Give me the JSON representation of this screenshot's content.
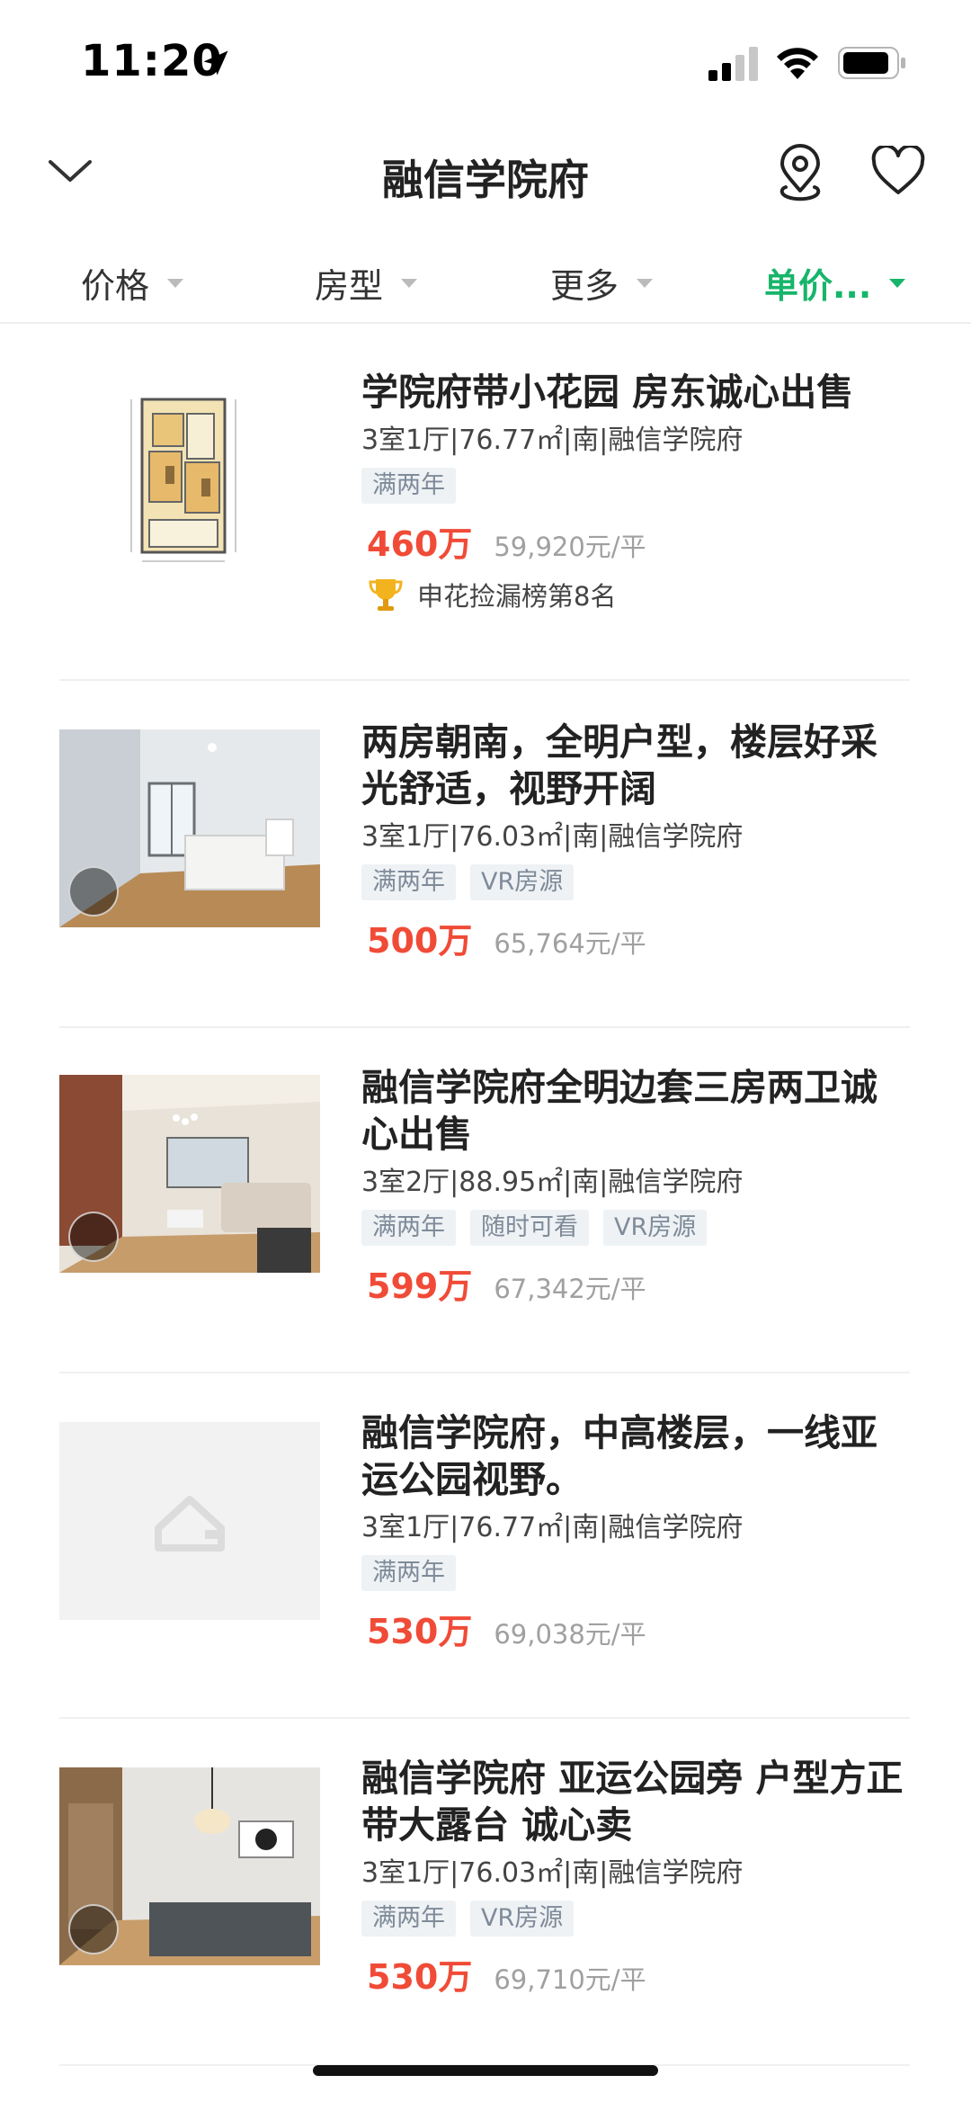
{
  "status_bar": {
    "time": "11:20"
  },
  "header": {
    "title": "融信学院府"
  },
  "filters": [
    {
      "label": "价格",
      "active": false
    },
    {
      "label": "房型",
      "active": false
    },
    {
      "label": "更多",
      "active": false
    },
    {
      "label": "单价...",
      "active": true
    }
  ],
  "listings": [
    {
      "title": "学院府带小花园  房东诚心出售",
      "meta": "3室1厅|76.77㎡|南|融信学院府",
      "tags": [
        "满两年"
      ],
      "price": "460万",
      "unit_price": "59,920元/平",
      "rank": "申花捡漏榜第8名",
      "image": "floor-plan"
    },
    {
      "title": "两房朝南，全明户型，楼层好采光舒适，视野开阔",
      "meta": "3室1厅|76.03㎡|南|融信学院府",
      "tags": [
        "满两年",
        "VR房源"
      ],
      "price": "500万",
      "unit_price": "65,764元/平",
      "image": "bedroom-photo"
    },
    {
      "title": "融信学院府全明边套三房两卫诚心出售",
      "meta": "3室2厅|88.95㎡|南|融信学院府",
      "tags": [
        "满两年",
        "随时可看",
        "VR房源"
      ],
      "price": "599万",
      "unit_price": "67,342元/平",
      "image": "living-room-photo"
    },
    {
      "title": "融信学院府，中高楼层，一线亚运公园视野。",
      "meta": "3室1厅|76.77㎡|南|融信学院府",
      "tags": [
        "满两年"
      ],
      "price": "530万",
      "unit_price": "69,038元/平",
      "image": "placeholder"
    },
    {
      "title": "融信学院府 亚运公园旁 户型方正 带大露台  诚心卖",
      "meta": "3室1厅|76.03㎡|南|融信学院府",
      "tags": [
        "满两年",
        "VR房源"
      ],
      "price": "530万",
      "unit_price": "69,710元/平",
      "image": "bedroom-photo"
    }
  ]
}
